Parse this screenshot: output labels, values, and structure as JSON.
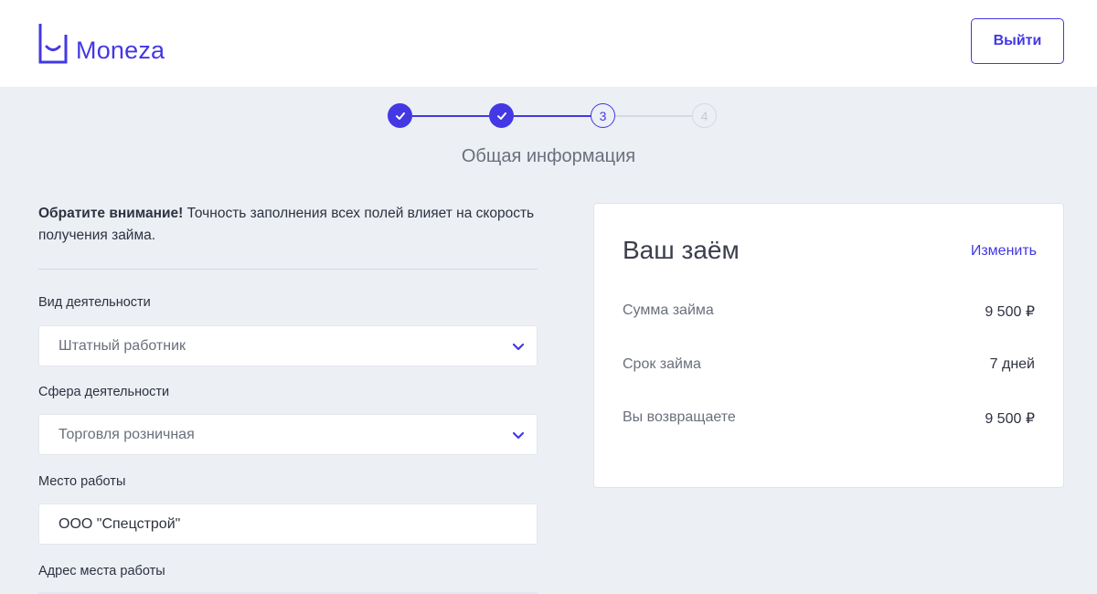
{
  "header": {
    "brand": "Moneza",
    "logout_label": "Выйти"
  },
  "stepper": {
    "steps": [
      {
        "label": "",
        "state": "done"
      },
      {
        "label": "",
        "state": "done"
      },
      {
        "label": "3",
        "state": "current"
      },
      {
        "label": "4",
        "state": "todo"
      }
    ],
    "title": "Общая информация"
  },
  "notice": {
    "bold": "Обратите внимание!",
    "text": " Точность заполнения всех полей влияет на скорость получения займа."
  },
  "form": {
    "activity_type": {
      "label": "Вид деятельности",
      "value": "Штатный работник"
    },
    "activity_sphere": {
      "label": "Сфера деятельности",
      "value": "Торговля розничная"
    },
    "workplace": {
      "label": "Место работы",
      "value": "ООО \"Спецстрой\""
    },
    "work_address": {
      "label": "Адрес места работы"
    }
  },
  "loan": {
    "title": "Ваш заём",
    "edit_label": "Изменить",
    "rows": [
      {
        "label": "Сумма займа",
        "value": "9 500 ₽"
      },
      {
        "label": "Срок займа",
        "value": "7 дней"
      },
      {
        "label": "Вы возвращаете",
        "value": "9 500 ₽"
      }
    ]
  },
  "colors": {
    "accent": "#4338e3",
    "background": "#eceff4",
    "card": "#ffffff"
  }
}
